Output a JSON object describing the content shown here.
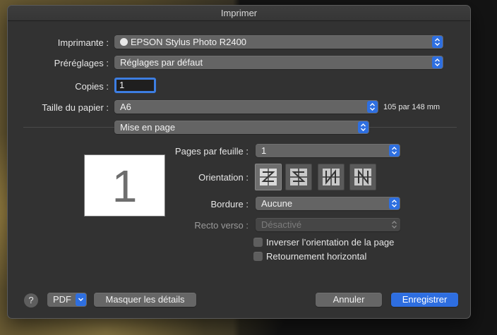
{
  "window": {
    "title": "Imprimer"
  },
  "printer": {
    "label": "Imprimante :",
    "value": "EPSON Stylus Photo R2400",
    "icon": "printer-icon"
  },
  "presets": {
    "label": "Préréglages :",
    "value": "Réglages par défaut"
  },
  "copies": {
    "label": "Copies :",
    "value": "1"
  },
  "paper": {
    "label": "Taille du papier :",
    "value": "A6",
    "dimensions": "105 par 148 mm"
  },
  "section": {
    "value": "Mise en page"
  },
  "preview": {
    "page_number": "1"
  },
  "layout": {
    "pages_per_sheet": {
      "label": "Pages par feuille :",
      "value": "1"
    },
    "orientation": {
      "label": "Orientation :",
      "options": [
        "orientation-z-left",
        "orientation-z-right",
        "orientation-n-left",
        "orientation-n-right"
      ],
      "selected_index": 0
    },
    "border": {
      "label": "Bordure :",
      "value": "Aucune"
    },
    "two_sided": {
      "label": "Recto verso :",
      "value": "Désactivé"
    },
    "reverse_orientation": {
      "label": "Inverser l’orientation de la page",
      "checked": false
    },
    "flip_horizontal": {
      "label": "Retournement horizontal",
      "checked": false
    }
  },
  "footer": {
    "help": "?",
    "pdf": "PDF",
    "hide_details": "Masquer les détails",
    "cancel": "Annuler",
    "save": "Enregistrer"
  },
  "colors": {
    "accent": "#2e6ee0",
    "window_bg": "#323232",
    "control_bg": "#646464"
  }
}
